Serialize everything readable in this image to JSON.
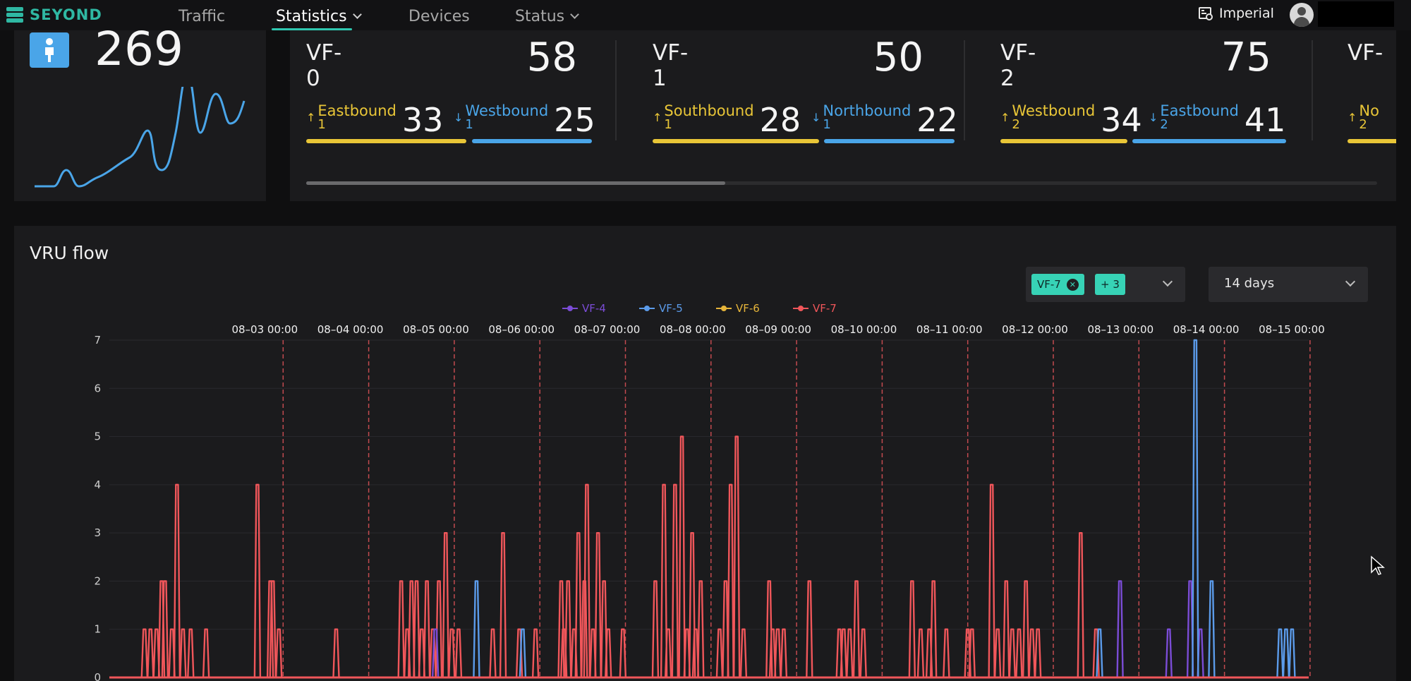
{
  "brand": {
    "name": "SEYOND"
  },
  "nav": {
    "items": [
      {
        "label": "Traffic",
        "has_dropdown": false,
        "active": false
      },
      {
        "label": "Statistics",
        "has_dropdown": true,
        "active": true
      },
      {
        "label": "Devices",
        "has_dropdown": false,
        "active": false
      },
      {
        "label": "Status",
        "has_dropdown": true,
        "active": false
      }
    ],
    "units_label": "Imperial",
    "units_icon": "ruler-settings-icon",
    "user_icon": "user-avatar-icon"
  },
  "summary": {
    "icon": "pedestrian-icon",
    "total": "269"
  },
  "zones": [
    {
      "name": "VF-0",
      "total": "58",
      "in": {
        "label": "Eastbound",
        "index": "1",
        "count": "33"
      },
      "out": {
        "label": "Westbound",
        "index": "1",
        "count": "25"
      }
    },
    {
      "name": "VF-1",
      "total": "50",
      "in": {
        "label": "Southbound",
        "index": "1",
        "count": "28"
      },
      "out": {
        "label": "Northbound",
        "index": "1",
        "count": "22"
      }
    },
    {
      "name": "VF-2",
      "total": "75",
      "in": {
        "label": "Westbound",
        "index": "2",
        "count": "34"
      },
      "out": {
        "label": "Eastbound",
        "index": "2",
        "count": "41"
      }
    },
    {
      "name": "VF-",
      "total": "",
      "in": {
        "label": "No",
        "index": "2",
        "count": ""
      },
      "out": {
        "label": "",
        "index": "",
        "count": ""
      }
    }
  ],
  "flow": {
    "title": "VRU flow",
    "zone_chip": "VF-7",
    "more_chip": "+ 3",
    "range": "14 days",
    "colors": {
      "VF-4": "#7b4cd6",
      "VF-5": "#5b9bea",
      "VF-6": "#e6b53a",
      "VF-7": "#f0565a"
    }
  },
  "chart_data": {
    "type": "line",
    "title": "",
    "xlabel": "",
    "ylabel": "",
    "ylim": [
      0,
      7
    ],
    "yticks": [
      "0",
      "1",
      "2",
      "3",
      "4",
      "5",
      "6",
      "7"
    ],
    "x_day_markers": [
      "08–03 00:00",
      "08–04 00:00",
      "08–05 00:00",
      "08–06 00:00",
      "08–07 00:00",
      "08–08 00:00",
      "08–09 00:00",
      "08–10 00:00",
      "08–11 00:00",
      "08–12 00:00",
      "08–13 00:00",
      "08–14 00:00",
      "08–15 00:00"
    ],
    "x_unit": "day offset from 08-02 00:00",
    "legend_position": "top-center",
    "series": [
      {
        "name": "VF-4",
        "points": [
          [
            2.78,
            1
          ],
          [
            10.78,
            2
          ],
          [
            11.35,
            1
          ],
          [
            11.6,
            2
          ],
          [
            11.72,
            1
          ]
        ]
      },
      {
        "name": "VF-5",
        "points": [
          [
            3.26,
            2
          ],
          [
            3.8,
            1
          ],
          [
            10.54,
            1
          ],
          [
            11.66,
            7
          ],
          [
            11.85,
            2
          ],
          [
            12.65,
            1
          ],
          [
            12.72,
            1
          ],
          [
            12.79,
            1
          ]
        ]
      },
      {
        "name": "VF-6",
        "points": []
      },
      {
        "name": "VF-7",
        "points": [
          [
            -0.62,
            1
          ],
          [
            -0.55,
            1
          ],
          [
            -0.48,
            1
          ],
          [
            -0.42,
            2
          ],
          [
            -0.38,
            2
          ],
          [
            -0.3,
            1
          ],
          [
            -0.24,
            4
          ],
          [
            -0.17,
            1
          ],
          [
            -0.08,
            1
          ],
          [
            0.1,
            1
          ],
          [
            0.7,
            4
          ],
          [
            0.85,
            2
          ],
          [
            0.88,
            2
          ],
          [
            0.95,
            1
          ],
          [
            1.62,
            1
          ],
          [
            2.38,
            2
          ],
          [
            2.45,
            1
          ],
          [
            2.5,
            2
          ],
          [
            2.56,
            2
          ],
          [
            2.62,
            1
          ],
          [
            2.68,
            2
          ],
          [
            2.75,
            1
          ],
          [
            2.82,
            2
          ],
          [
            2.9,
            3
          ],
          [
            2.97,
            1
          ],
          [
            3.05,
            1
          ],
          [
            3.45,
            1
          ],
          [
            3.57,
            3
          ],
          [
            3.76,
            1
          ],
          [
            3.95,
            1
          ],
          [
            4.25,
            2
          ],
          [
            4.28,
            1
          ],
          [
            4.33,
            2
          ],
          [
            4.4,
            1
          ],
          [
            4.45,
            3
          ],
          [
            4.52,
            2
          ],
          [
            4.55,
            4
          ],
          [
            4.62,
            1
          ],
          [
            4.68,
            3
          ],
          [
            4.75,
            2
          ],
          [
            4.8,
            1
          ],
          [
            4.97,
            1
          ],
          [
            5.35,
            2
          ],
          [
            5.45,
            4
          ],
          [
            5.5,
            1
          ],
          [
            5.58,
            4
          ],
          [
            5.66,
            5
          ],
          [
            5.72,
            1
          ],
          [
            5.78,
            3
          ],
          [
            5.82,
            1
          ],
          [
            5.88,
            2
          ],
          [
            6.1,
            1
          ],
          [
            6.17,
            2
          ],
          [
            6.23,
            4
          ],
          [
            6.3,
            5
          ],
          [
            6.38,
            1
          ],
          [
            6.68,
            2
          ],
          [
            6.72,
            1
          ],
          [
            6.78,
            1
          ],
          [
            6.85,
            1
          ],
          [
            7.15,
            2
          ],
          [
            7.5,
            1
          ],
          [
            7.55,
            1
          ],
          [
            7.62,
            1
          ],
          [
            7.7,
            2
          ],
          [
            7.78,
            1
          ],
          [
            8.35,
            2
          ],
          [
            8.45,
            1
          ],
          [
            8.55,
            1
          ],
          [
            8.6,
            2
          ],
          [
            8.75,
            1
          ],
          [
            9.0,
            1
          ],
          [
            9.05,
            1
          ],
          [
            9.28,
            4
          ],
          [
            9.35,
            1
          ],
          [
            9.45,
            2
          ],
          [
            9.52,
            1
          ],
          [
            9.6,
            1
          ],
          [
            9.68,
            2
          ],
          [
            9.75,
            1
          ],
          [
            9.82,
            1
          ],
          [
            10.32,
            3
          ],
          [
            10.5,
            1
          ]
        ]
      }
    ]
  }
}
